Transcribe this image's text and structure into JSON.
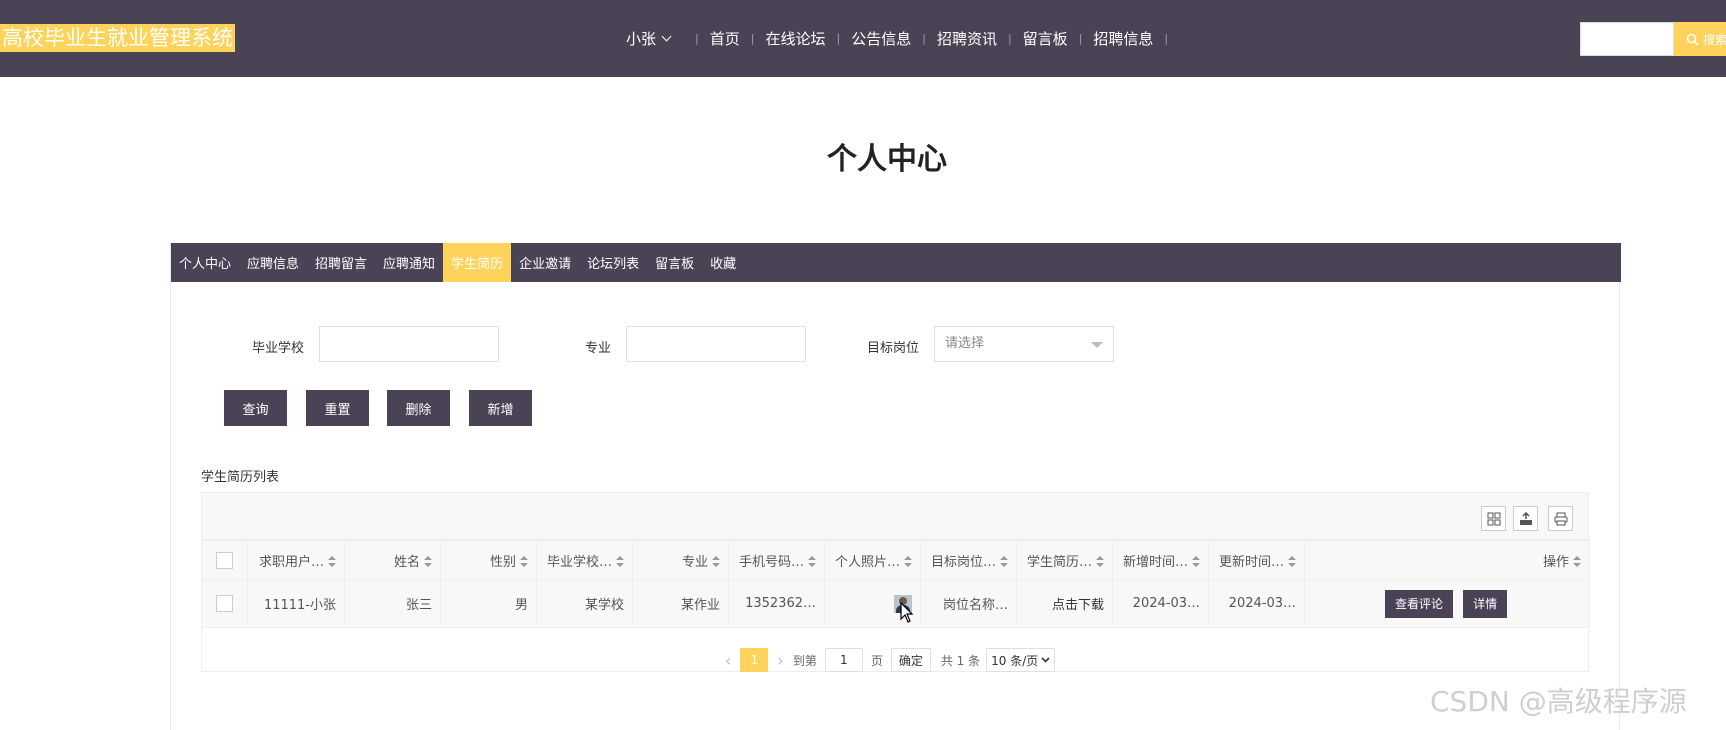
{
  "header": {
    "site_title": "高校毕业生就业管理系统",
    "user_menu": "小张",
    "nav_items": [
      {
        "label": "首页"
      },
      {
        "label": "在线论坛"
      },
      {
        "label": "公告信息"
      },
      {
        "label": "招聘资讯"
      },
      {
        "label": "留言板"
      },
      {
        "label": "招聘信息"
      }
    ],
    "search_button": "搜索",
    "accent_color": "#fdd35c",
    "bar_color": "#4a4356"
  },
  "page_title": "个人中心",
  "tabs": [
    {
      "label": "个人中心",
      "active": false
    },
    {
      "label": "应聘信息",
      "active": false
    },
    {
      "label": "招聘留言",
      "active": false
    },
    {
      "label": "应聘通知",
      "active": false
    },
    {
      "label": "学生简历",
      "active": true
    },
    {
      "label": "企业邀请",
      "active": false
    },
    {
      "label": "论坛列表",
      "active": false
    },
    {
      "label": "留言板",
      "active": false
    },
    {
      "label": "收藏",
      "active": false
    }
  ],
  "filters": {
    "school_label": "毕业学校",
    "school_value": "",
    "major_label": "专业",
    "major_value": "",
    "position_label": "目标岗位",
    "position_placeholder": "请选择"
  },
  "actions": {
    "query": "查询",
    "reset": "重置",
    "delete": "删除",
    "add": "新增"
  },
  "list_title": "学生简历列表",
  "table": {
    "columns": [
      "求职用户…",
      "姓名",
      "性别",
      "毕业学校…",
      "专业",
      "手机号码…",
      "个人照片…",
      "目标岗位…",
      "学生简历…",
      "新增时间…",
      "更新时间…",
      "操作"
    ],
    "rows": [
      {
        "user": "11111-小张",
        "name": "张三",
        "gender": "男",
        "school": "某学校",
        "major": "某作业",
        "phone": "1352362…",
        "photo": "photo-icon",
        "position": "岗位名称…",
        "resume": "点击下载",
        "created": "2024-03…",
        "updated": "2024-03…",
        "op_comment": "查看评论",
        "op_detail": "详情"
      }
    ]
  },
  "pagination": {
    "current_page": "1",
    "goto_prefix": "到第",
    "goto_value": "1",
    "goto_suffix": "页",
    "confirm": "确定",
    "total": "共 1 条",
    "page_size": "10 条/页"
  },
  "watermark": "CSDN @高级程序源"
}
